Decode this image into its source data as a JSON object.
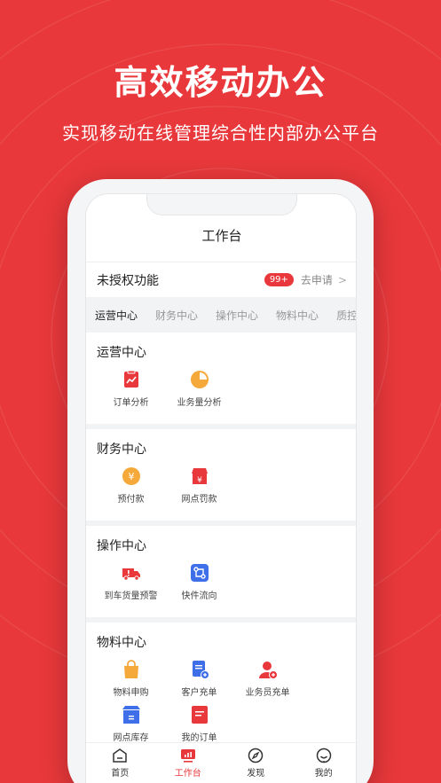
{
  "hero": {
    "title": "高效移动办公",
    "subtitle": "实现移动在线管理综合性内部办公平台"
  },
  "app": {
    "title": "工作台",
    "unauth": {
      "label": "未授权功能",
      "badge": "99+",
      "action": "去申请",
      "chevron": ">"
    },
    "tabs": [
      {
        "label": "运营中心",
        "active": true
      },
      {
        "label": "财务中心"
      },
      {
        "label": "操作中心"
      },
      {
        "label": "物料中心"
      },
      {
        "label": "质控"
      }
    ],
    "sections": [
      {
        "title": "运营中心",
        "items": [
          {
            "label": "订单分析",
            "icon": "order-analysis-icon",
            "color": "#e8383b"
          },
          {
            "label": "业务量分析",
            "icon": "pie-chart-icon",
            "color": "#f4a93a"
          }
        ]
      },
      {
        "title": "财务中心",
        "items": [
          {
            "label": "预付款",
            "icon": "yuan-coin-icon",
            "color": "#f4a93a"
          },
          {
            "label": "网点罚款",
            "icon": "store-fine-icon",
            "color": "#e8383b"
          }
        ]
      },
      {
        "title": "操作中心",
        "items": [
          {
            "label": "到车货量预警",
            "icon": "truck-alert-icon",
            "color": "#e8383b"
          },
          {
            "label": "快件流向",
            "icon": "flow-icon",
            "color": "#3f6fe8"
          }
        ]
      },
      {
        "title": "物料中心",
        "items": [
          {
            "label": "物料申购",
            "icon": "shopping-bag-icon",
            "color": "#f4a93a"
          },
          {
            "label": "客户充单",
            "icon": "document-plus-icon",
            "color": "#3f6fe8"
          },
          {
            "label": "业务员充单",
            "icon": "user-plus-icon",
            "color": "#e8383b"
          },
          {
            "label": "网点库存",
            "icon": "inventory-box-icon",
            "color": "#3f6fe8"
          },
          {
            "label": "我的订单",
            "icon": "my-order-icon",
            "color": "#e8383b"
          }
        ]
      }
    ],
    "tabbar": [
      {
        "label": "首页",
        "icon": "home-icon"
      },
      {
        "label": "工作台",
        "icon": "workbench-icon",
        "active": true
      },
      {
        "label": "发现",
        "icon": "compass-icon"
      },
      {
        "label": "我的",
        "icon": "profile-icon"
      }
    ]
  },
  "colors": {
    "brand": "#e8383b",
    "orange": "#f4a93a",
    "blue": "#3f6fe8",
    "background": "#f2f3f5"
  }
}
